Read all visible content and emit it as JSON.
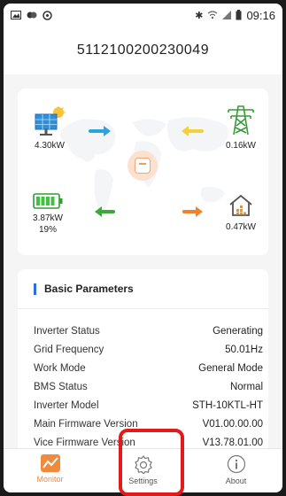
{
  "status_bar": {
    "time": "09:16",
    "left_icons": [
      "gallery-icon",
      "messages-icon",
      "data-saver-icon"
    ],
    "right_icons": [
      "bluetooth-icon",
      "wifi-icon",
      "signal-icon",
      "battery-icon"
    ]
  },
  "header": {
    "title": "5112100200230049"
  },
  "flow": {
    "solar": {
      "value": "4.30kW",
      "icon": "solar-panel-icon"
    },
    "grid": {
      "value": "0.16kW",
      "icon": "power-tower-icon"
    },
    "battery": {
      "value": "3.87kW",
      "soc": "19%",
      "icon": "battery-icon"
    },
    "home": {
      "value": "0.47kW",
      "icon": "home-icon"
    },
    "colors": {
      "solar_arrow": "#2aa4e0",
      "grid_arrow": "#f2d23c",
      "battery_arrow": "#3aa83a",
      "home_arrow": "#f0822a",
      "inverter": "#f39d5c"
    }
  },
  "params": {
    "title": "Basic Parameters",
    "rows": [
      {
        "label": "Inverter Status",
        "value": "Generating"
      },
      {
        "label": "Grid Frequency",
        "value": "50.01Hz"
      },
      {
        "label": "Work Mode",
        "value": "General Mode"
      },
      {
        "label": "BMS Status",
        "value": "Normal"
      },
      {
        "label": "Inverter Model",
        "value": "STH-10KTL-HT"
      },
      {
        "label": "Main Firmware Version",
        "value": "V01.00.00.00"
      },
      {
        "label": "Vice Firmware Version",
        "value": "V13.78.01.00"
      }
    ]
  },
  "tabs": [
    {
      "label": "Monitor",
      "icon": "chart-icon",
      "active": true
    },
    {
      "label": "Settings",
      "icon": "gear-icon",
      "active": false
    },
    {
      "label": "About",
      "icon": "info-icon",
      "active": false
    }
  ],
  "accent_color": "#f08a3c",
  "highlight_color": "#e11b1b"
}
